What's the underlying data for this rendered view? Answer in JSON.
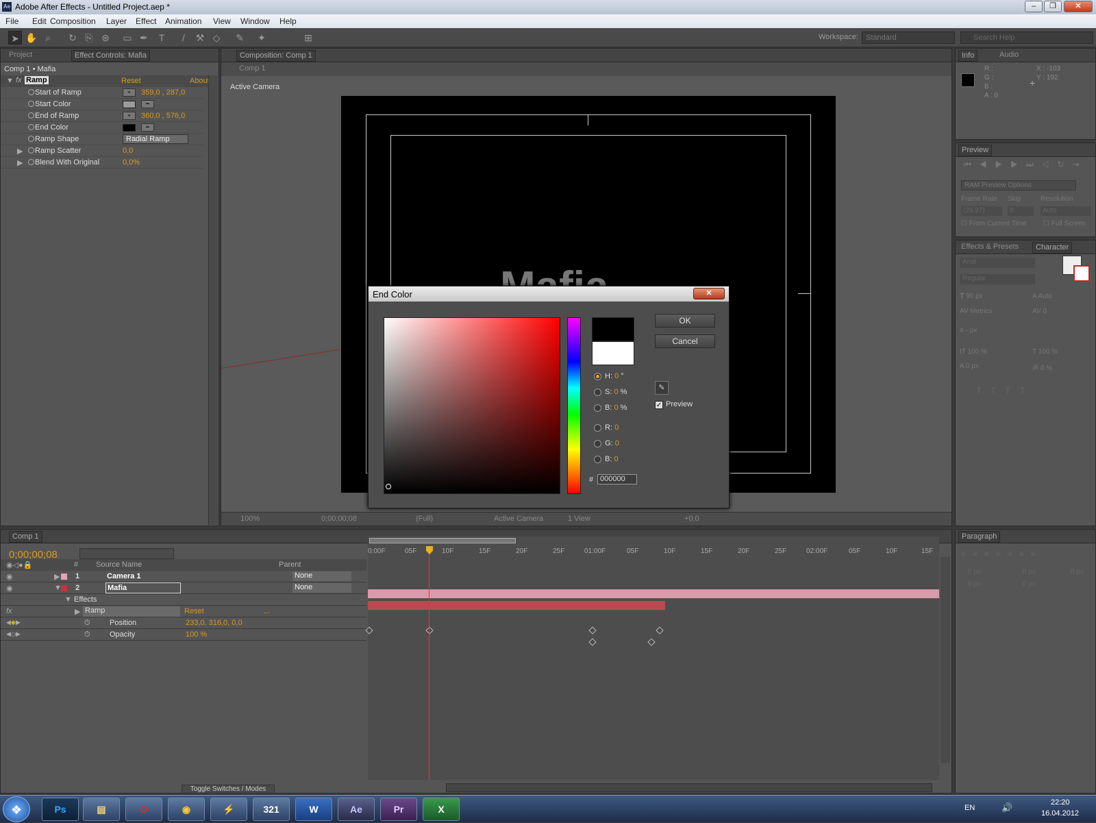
{
  "window": {
    "title": "Adobe After Effects - Untitled Project.aep *",
    "app_icon": "Ae"
  },
  "menu": [
    "File",
    "Edit",
    "Composition",
    "Layer",
    "Effect",
    "View",
    "Window",
    "Help"
  ],
  "toolbar": {
    "workspace_label": "Workspace:",
    "workspace_value": "Standard",
    "search_placeholder": "Search Help"
  },
  "project_panel": {
    "tabs": [
      "Project",
      "Effect Controls: Mafia"
    ],
    "breadcrumb": "Comp 1 • Mafia"
  },
  "effect_controls": {
    "effect_name": "Ramp",
    "reset": "Reset",
    "about": "About...",
    "rows": [
      {
        "label": "Start of Ramp",
        "value": "359,0 , 287,0"
      },
      {
        "label": "Start Color",
        "value": ""
      },
      {
        "label": "End of Ramp",
        "value": "360,0 , 576,0"
      },
      {
        "label": "End Color",
        "value": ""
      },
      {
        "label": "Ramp Shape",
        "value": "Radial Ramp"
      },
      {
        "label": "Ramp Scatter",
        "value": "0,0"
      },
      {
        "label": "Blend With Original",
        "value": "0,0%"
      }
    ],
    "start_color": "#9a9a9a",
    "end_color": "#000000"
  },
  "composition": {
    "tab": "Composition: Comp 1",
    "sub_tab": "Comp 1",
    "view_label": "Active Camera",
    "layer_text": "Mafia",
    "footer": {
      "zoom": "100%",
      "timecode": "0;00;00;08",
      "quality": "(Full)",
      "camera": "Active Camera",
      "views": "1 View",
      "exposure": "+0,0"
    }
  },
  "info_panel": {
    "tabs": [
      "Info",
      "Audio"
    ],
    "r": "R :",
    "g": "G :",
    "b": "B :",
    "a": "A : 0",
    "x": "X : -103",
    "y": "Y : 192"
  },
  "preview_panel": {
    "tab": "Preview",
    "ram_options": "RAM Preview Options",
    "frame_rate_label": "Frame Rate",
    "skip_label": "Skip",
    "resolution_label": "Resolution",
    "frame_rate": "(29,97)",
    "skip": "0",
    "resolution": "Auto",
    "from_current": "From Current Time",
    "full_screen": "Full Screen"
  },
  "character_panel": {
    "tabs": [
      "Effects & Presets",
      "Character"
    ],
    "font": "Arial",
    "style": "Regular",
    "size": "90 px",
    "leading": "Auto",
    "kerning": "Metrics",
    "tracking": "0",
    "stroke": "- px",
    "vscale": "100 %",
    "hscale": "100 %",
    "baseline": "0 px",
    "tsume": "0 %"
  },
  "paragraph_panel": {
    "tab": "Paragraph",
    "indent_values": [
      "0 px",
      "0 px",
      "0 px",
      "0 px",
      "0 px"
    ]
  },
  "dialog": {
    "title": "End Color",
    "ok": "OK",
    "cancel": "Cancel",
    "preview_label": "Preview",
    "preview_checked": true,
    "h_label": "H:",
    "h": "0",
    "h_unit": "°",
    "s_label": "S:",
    "s": "0",
    "s_unit": "%",
    "bv_label": "B:",
    "bv": "0",
    "bv_unit": "%",
    "r_label": "R:",
    "r": "0",
    "g_label": "G:",
    "g": "0",
    "b_label": "B:",
    "b": "0",
    "hash": "#",
    "hex": "000000",
    "new_color": "#000000",
    "old_color": "#ffffff",
    "field_hue": "#ff0000"
  },
  "timeline": {
    "tab": "Comp 1",
    "timecode": "0;00;00;08",
    "col_headers": {
      "num": "#",
      "source": "Source Name",
      "parent": "Parent"
    },
    "ruler": [
      "0:00F",
      "05F",
      "10F",
      "15F",
      "20F",
      "25F",
      "01:00F",
      "05F",
      "10F",
      "15F",
      "20F",
      "25F",
      "02:00F",
      "05F",
      "10F",
      "15F"
    ],
    "layers": [
      {
        "num": "1",
        "name": "Camera 1",
        "parent": "None",
        "color": "#e6a3b5"
      },
      {
        "num": "2",
        "name": "Mafia",
        "parent": "None",
        "color": "#c8323c"
      }
    ],
    "effects_label": "Effects",
    "ramp_label": "Ramp",
    "ramp_reset": "Reset",
    "ramp_extra": "...",
    "position_label": "Position",
    "position_value": "233,0, 316,0, 0,0",
    "opacity_label": "Opacity",
    "opacity_value": "100 %",
    "toggle": "Toggle Switches / Modes"
  },
  "taskbar": {
    "apps": [
      "Ps",
      "Files",
      "Opera",
      "Chrome",
      "Winamp",
      "321",
      "W",
      "Ae",
      "Pr",
      "X"
    ],
    "lang": "EN",
    "time": "22:20",
    "date": "16.04.2012"
  }
}
